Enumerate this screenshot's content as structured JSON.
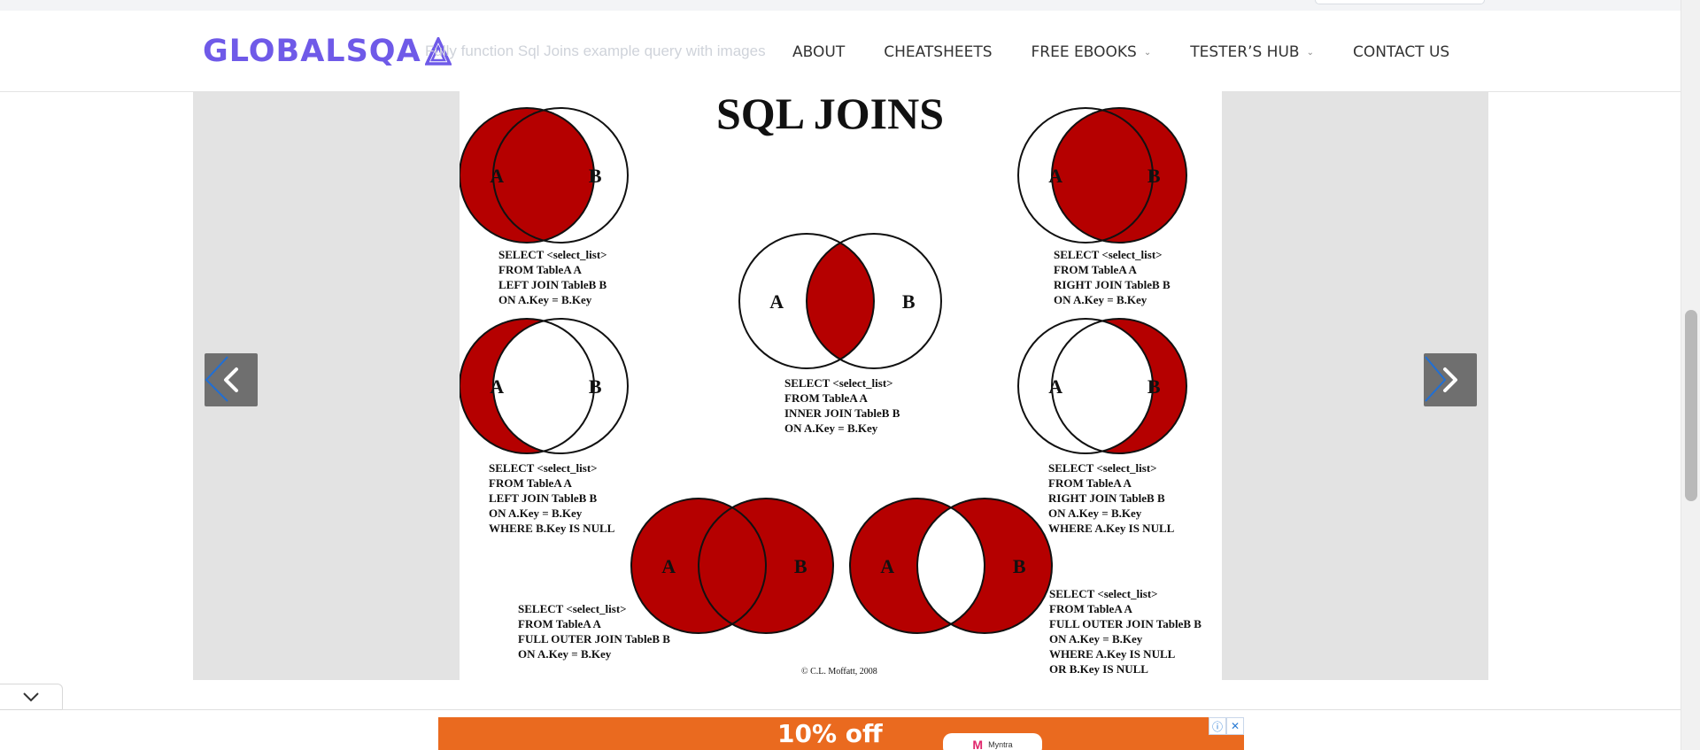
{
  "header": {
    "logo_text": "GLOBALSQA",
    "ghost_text": "Fully function Sql Joins example query with images",
    "nav": [
      {
        "label": "ABOUT",
        "dropdown": false
      },
      {
        "label": "CHEATSHEETS",
        "dropdown": false
      },
      {
        "label": "FREE EBOOKS",
        "dropdown": true
      },
      {
        "label": "TESTER’S HUB",
        "dropdown": true
      },
      {
        "label": "CONTACT US",
        "dropdown": false
      }
    ],
    "brand_color": "#6f5ae8"
  },
  "slider": {
    "prev_icon": "chevron-left-icon",
    "next_icon": "chevron-right-icon",
    "diagram": {
      "title": "SQL JOINS",
      "label_a": "A",
      "label_b": "B",
      "left_join": [
        "SELECT <select_list>",
        "FROM TableA A",
        "LEFT JOIN TableB B",
        "ON A.Key = B.Key"
      ],
      "right_join": [
        "SELECT <select_list>",
        "FROM TableA A",
        "RIGHT JOIN TableB B",
        "ON A.Key = B.Key"
      ],
      "inner_join": [
        "SELECT <select_list>",
        "FROM TableA A",
        "INNER JOIN TableB B",
        "ON A.Key = B.Key"
      ],
      "left_excl": [
        "SELECT <select_list>",
        "FROM TableA A",
        "LEFT JOIN TableB B",
        "ON A.Key = B.Key",
        "WHERE B.Key IS NULL"
      ],
      "right_excl": [
        "SELECT <select_list>",
        "FROM TableA A",
        "RIGHT JOIN TableB B",
        "ON A.Key = B.Key",
        "WHERE A.Key IS NULL"
      ],
      "full_outer": [
        "SELECT <select_list>",
        "FROM TableA A",
        "FULL OUTER JOIN TableB B",
        "ON A.Key = B.Key"
      ],
      "full_outer_excl": [
        "SELECT <select_list>",
        "FROM TableA A",
        "FULL OUTER JOIN TableB B",
        "ON A.Key = B.Key",
        "WHERE A.Key IS NULL",
        "OR B.Key IS NULL"
      ],
      "copyright": "© C.L. Moffatt, 2008",
      "fill_color": "#b50000"
    }
  },
  "bottom": {
    "collapse_icon": "chevron-down-icon",
    "ad": {
      "headline": "10% off",
      "brand_short": "M",
      "brand_name": "Myntra",
      "info_icon": "info-icon",
      "close_icon": "close-icon"
    }
  }
}
